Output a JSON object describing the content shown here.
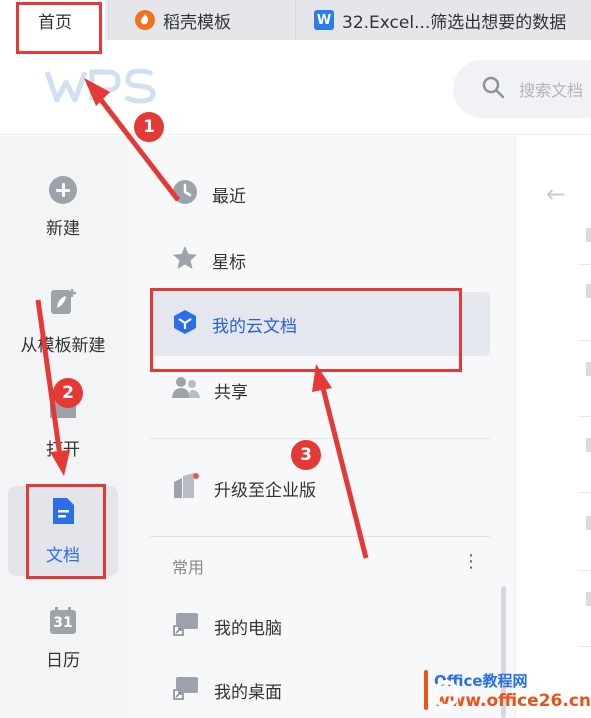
{
  "tabs": [
    {
      "label": "首页"
    },
    {
      "label": "稻壳模板"
    },
    {
      "label": "32.Excel...筛选出想要的数据",
      "icon_letter": "W"
    }
  ],
  "header": {
    "logo_text": "WPS",
    "search_placeholder": "搜索文档"
  },
  "leftnav": {
    "new": "新建",
    "template": "从模板新建",
    "open": "打开",
    "docs": "文档",
    "calendar": "日历",
    "calendar_number": "31"
  },
  "midnav": {
    "recent": "最近",
    "star": "星标",
    "cloud": "我的云文档",
    "share": "共享",
    "upgrade": "升级至企业版",
    "section_common": "常用",
    "section_more": "⋮",
    "computer": "我的电脑",
    "desktop": "我的桌面"
  },
  "annotations": {
    "step1": "1",
    "step2": "2",
    "step3": "3"
  },
  "watermark": {
    "line1": "Office教程网",
    "line2": "www.office26.cn"
  },
  "colors": {
    "accent": "#2a6fe8",
    "annotation": "#e53935",
    "watermark_orange": "#e8541c"
  }
}
